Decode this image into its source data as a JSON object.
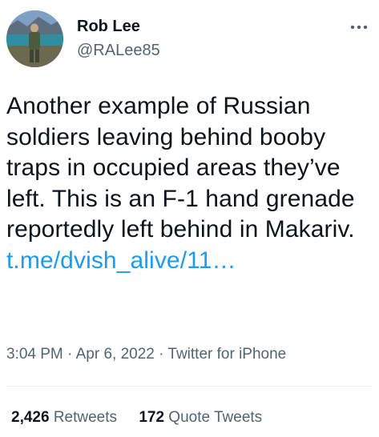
{
  "author": {
    "display_name": "Rob Lee",
    "handle": "@RALee85",
    "avatar_icon": "profile-photo"
  },
  "more_icon": "more-dots-icon",
  "tweet": {
    "text": "Another example of Russian soldiers leaving behind booby traps in occupied areas they’ve left. This is an F-1 hand grenade reportedly left behind in Makariv.",
    "link": "t.me/dvish_alive/11…"
  },
  "meta": {
    "time": "3:04 PM",
    "separator": "·",
    "date": "Apr 6, 2022",
    "source": "Twitter for iPhone"
  },
  "stats": {
    "retweets_count": "2,426",
    "retweets_label": "Retweets",
    "quotes_count": "172",
    "quotes_label": "Quote Tweets"
  },
  "colors": {
    "link": "#1d9bf0",
    "secondary_text": "#536471",
    "primary_text": "#0f1419"
  }
}
